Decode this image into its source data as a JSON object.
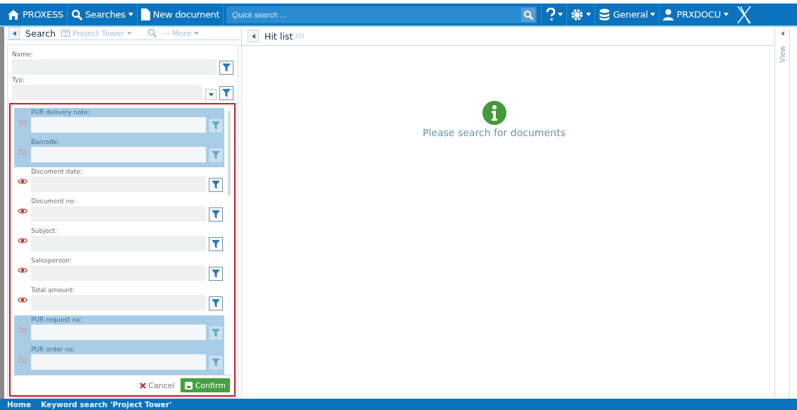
{
  "topbar": {
    "brand": "PROXESS",
    "searches": "Searches",
    "new_document": "New document",
    "quick_search": {
      "placeholder": "Quick search ..."
    },
    "database": "General",
    "user": "PRXDOCU"
  },
  "toolbar": {
    "search": "Search",
    "project": "Project Tower",
    "more": "More",
    "hit_list": "Hit list",
    "hit_count": "(0)"
  },
  "filters": [
    {
      "label": "Name:",
      "kind": "text"
    },
    {
      "label": "Typ:",
      "kind": "dropdown"
    }
  ],
  "fields": [
    {
      "label": "PUR delivery note:",
      "hidden": true
    },
    {
      "label": "Barcode:",
      "hidden": true
    },
    {
      "label": "Document date:",
      "hidden": false
    },
    {
      "label": "Document no:",
      "hidden": false
    },
    {
      "label": "Subject:",
      "hidden": false
    },
    {
      "label": "Salesperson:",
      "hidden": false
    },
    {
      "label": "Total amount:",
      "hidden": false
    },
    {
      "label": "PUR request no:",
      "hidden": true
    },
    {
      "label": "PUR order no:",
      "hidden": true
    }
  ],
  "buttons": {
    "cancel": "Cancel",
    "confirm": "Confirm"
  },
  "message": "Please search for documents",
  "side_panel": {
    "label": "View"
  },
  "status_bar": {
    "home": "Home",
    "breadcrumb": "Keyword search 'Project Tower'"
  }
}
